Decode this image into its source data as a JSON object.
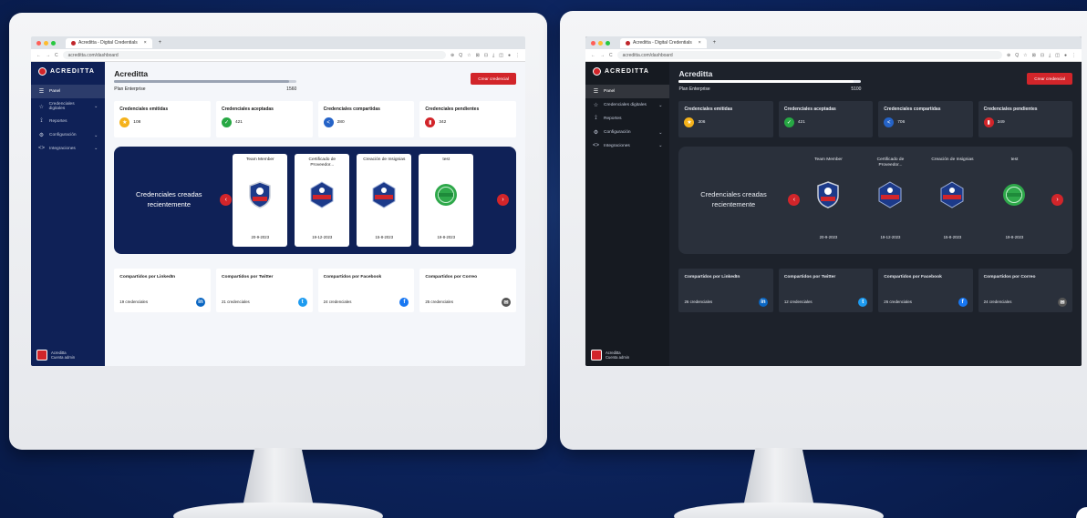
{
  "browser": {
    "tab_title": "Acreditta - Digital Credentials",
    "tab_close": "×",
    "new_tab": "+",
    "address": "acreditta.com/dashboard",
    "nav_back": "←",
    "nav_forward": "→",
    "nav_reload": "C",
    "tools": [
      "⊕",
      "Q",
      "☆",
      "⊠",
      "⊡",
      "⤓",
      "◫",
      "●",
      "⋮"
    ]
  },
  "app": {
    "brand": "ACREDITTA",
    "sidebar": {
      "items": [
        {
          "icon": "☰",
          "label": "Panel"
        },
        {
          "icon": "☆",
          "label": "Credenciales digitales",
          "chevron": "⌄"
        },
        {
          "icon": "⟟",
          "label": "Reportes"
        },
        {
          "icon": "⚙",
          "label": "Configuración",
          "chevron": "⌄"
        },
        {
          "icon": "<>",
          "label": "Integraciones",
          "chevron": "⌄"
        }
      ],
      "user_name": "Acreditta",
      "user_sub": "Cuenta admin"
    },
    "header": {
      "title": "Acreditta",
      "plan": "Plan Enterprise",
      "plan_limit_light": "1560",
      "plan_limit_dark": "5100",
      "plan_progress": 0.96,
      "create_button": "Crear credencial"
    },
    "stats": [
      {
        "label": "Credenciales emitidas",
        "icon": "★",
        "color": "#f5b21b",
        "value_light": "108",
        "value_dark": "306"
      },
      {
        "label": "Credenciales aceptadas",
        "icon": "✓",
        "color": "#27a844",
        "value_light": "421",
        "value_dark": "421"
      },
      {
        "label": "Credenciales compartidas",
        "icon": "<",
        "color": "#2563c7",
        "value_light": "280",
        "value_dark": "706"
      },
      {
        "label": "Credenciales pendientes",
        "icon": "▮",
        "color": "#d2252a",
        "value_light": "342",
        "value_dark": "349"
      }
    ],
    "carousel": {
      "title_light": "Credenciales creadas recientemente",
      "title_dark": "Credenciales creadas recientemente",
      "prev": "‹",
      "next": "›",
      "cards": [
        {
          "name": "Team Member",
          "date": "20-9-2023",
          "badge": "shield-red-blue"
        },
        {
          "name": "Certificado de Proveedor...",
          "date": "19-12-2023",
          "badge": "hex-blue-red"
        },
        {
          "name": "Creación de Insignias",
          "date": "15-8-2023",
          "badge": "hex-blue-red"
        },
        {
          "name": "test",
          "date": "19-8-2023",
          "badge": "circle-green"
        }
      ]
    },
    "shares": [
      {
        "label": "Compartidos por LinkedIn",
        "count_light": "19 credenciales",
        "count_dark": "26 credenciales",
        "icon": "in",
        "color": "#0a66c2"
      },
      {
        "label": "Compartidos por Twitter",
        "count_light": "21 credenciales",
        "count_dark": "12 credenciales",
        "icon": "t",
        "color": "#1d9bf0"
      },
      {
        "label": "Compartidos por Facebook",
        "count_light": "24 credenciales",
        "count_dark": "26 credenciales",
        "icon": "f",
        "color": "#1877f2"
      },
      {
        "label": "Compartidos por Correo",
        "count_light": "25 credenciales",
        "count_dark": "24 credenciales",
        "icon": "✉",
        "color": "#555555"
      }
    ]
  },
  "colors": {
    "brand_red": "#d2252a",
    "navy": "#0f2157",
    "dark_panel": "#2a303b",
    "background": "#0d2560"
  }
}
